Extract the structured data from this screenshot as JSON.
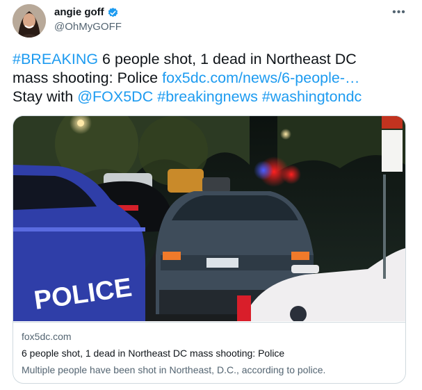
{
  "author": {
    "name": "angie goff",
    "handle": "@OhMyGOFF",
    "verified_icon": "verified-badge-icon",
    "colors": {
      "verified": "#1d9bf0"
    }
  },
  "more_icon": "ellipsis-icon",
  "more_label": "•••",
  "tweet": {
    "line1": [
      {
        "text": "#BREAKING",
        "link": true
      },
      {
        "text": " 6 people shot, 1 dead in Northeast DC",
        "link": false
      }
    ],
    "line2": [
      {
        "text": "mass shooting: Police ",
        "link": false
      },
      {
        "text": "fox5dc.com/news/6-people-…",
        "link": true
      }
    ],
    "line3": [
      {
        "text": "Stay with ",
        "link": false
      },
      {
        "text": "@FOX5DC",
        "link": true
      },
      {
        "text": " ",
        "link": false
      },
      {
        "text": "#breakingnews",
        "link": true
      },
      {
        "text": " ",
        "link": false
      },
      {
        "text": "#washingtondc",
        "link": true
      }
    ]
  },
  "card": {
    "domain": "fox5dc.com",
    "title": "6 people shot, 1 dead in Northeast DC mass shooting: Police",
    "description": "Multiple people have been shot in Northeast, D.C., according to police.",
    "image_text": {
      "police_car_lettering": "POLICE"
    }
  },
  "colors": {
    "link": "#1d9bf0",
    "text": "#0f1419",
    "secondary": "#536471",
    "border": "#cfd9de"
  }
}
